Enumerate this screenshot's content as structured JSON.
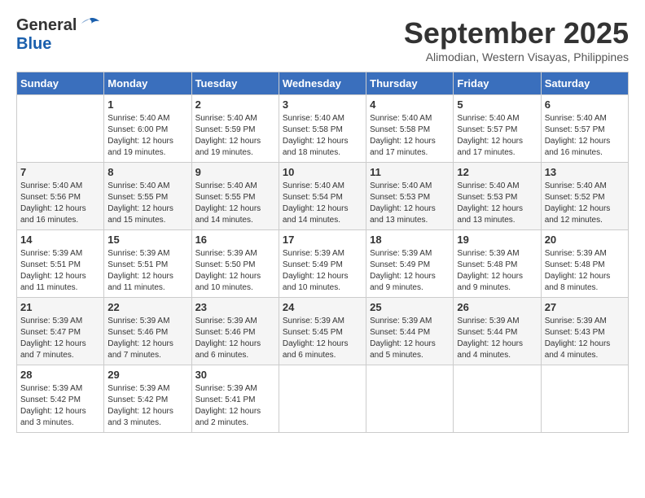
{
  "header": {
    "logo": {
      "general": "General",
      "blue": "Blue"
    },
    "title": "September 2025",
    "subtitle": "Alimodian, Western Visayas, Philippines"
  },
  "days_of_week": [
    "Sunday",
    "Monday",
    "Tuesday",
    "Wednesday",
    "Thursday",
    "Friday",
    "Saturday"
  ],
  "weeks": [
    [
      {
        "day": "",
        "sunrise": "",
        "sunset": "",
        "daylight": ""
      },
      {
        "day": "1",
        "sunrise": "Sunrise: 5:40 AM",
        "sunset": "Sunset: 6:00 PM",
        "daylight": "Daylight: 12 hours and 19 minutes."
      },
      {
        "day": "2",
        "sunrise": "Sunrise: 5:40 AM",
        "sunset": "Sunset: 5:59 PM",
        "daylight": "Daylight: 12 hours and 19 minutes."
      },
      {
        "day": "3",
        "sunrise": "Sunrise: 5:40 AM",
        "sunset": "Sunset: 5:58 PM",
        "daylight": "Daylight: 12 hours and 18 minutes."
      },
      {
        "day": "4",
        "sunrise": "Sunrise: 5:40 AM",
        "sunset": "Sunset: 5:58 PM",
        "daylight": "Daylight: 12 hours and 17 minutes."
      },
      {
        "day": "5",
        "sunrise": "Sunrise: 5:40 AM",
        "sunset": "Sunset: 5:57 PM",
        "daylight": "Daylight: 12 hours and 17 minutes."
      },
      {
        "day": "6",
        "sunrise": "Sunrise: 5:40 AM",
        "sunset": "Sunset: 5:57 PM",
        "daylight": "Daylight: 12 hours and 16 minutes."
      }
    ],
    [
      {
        "day": "7",
        "sunrise": "Sunrise: 5:40 AM",
        "sunset": "Sunset: 5:56 PM",
        "daylight": "Daylight: 12 hours and 16 minutes."
      },
      {
        "day": "8",
        "sunrise": "Sunrise: 5:40 AM",
        "sunset": "Sunset: 5:55 PM",
        "daylight": "Daylight: 12 hours and 15 minutes."
      },
      {
        "day": "9",
        "sunrise": "Sunrise: 5:40 AM",
        "sunset": "Sunset: 5:55 PM",
        "daylight": "Daylight: 12 hours and 14 minutes."
      },
      {
        "day": "10",
        "sunrise": "Sunrise: 5:40 AM",
        "sunset": "Sunset: 5:54 PM",
        "daylight": "Daylight: 12 hours and 14 minutes."
      },
      {
        "day": "11",
        "sunrise": "Sunrise: 5:40 AM",
        "sunset": "Sunset: 5:53 PM",
        "daylight": "Daylight: 12 hours and 13 minutes."
      },
      {
        "day": "12",
        "sunrise": "Sunrise: 5:40 AM",
        "sunset": "Sunset: 5:53 PM",
        "daylight": "Daylight: 12 hours and 13 minutes."
      },
      {
        "day": "13",
        "sunrise": "Sunrise: 5:40 AM",
        "sunset": "Sunset: 5:52 PM",
        "daylight": "Daylight: 12 hours and 12 minutes."
      }
    ],
    [
      {
        "day": "14",
        "sunrise": "Sunrise: 5:39 AM",
        "sunset": "Sunset: 5:51 PM",
        "daylight": "Daylight: 12 hours and 11 minutes."
      },
      {
        "day": "15",
        "sunrise": "Sunrise: 5:39 AM",
        "sunset": "Sunset: 5:51 PM",
        "daylight": "Daylight: 12 hours and 11 minutes."
      },
      {
        "day": "16",
        "sunrise": "Sunrise: 5:39 AM",
        "sunset": "Sunset: 5:50 PM",
        "daylight": "Daylight: 12 hours and 10 minutes."
      },
      {
        "day": "17",
        "sunrise": "Sunrise: 5:39 AM",
        "sunset": "Sunset: 5:49 PM",
        "daylight": "Daylight: 12 hours and 10 minutes."
      },
      {
        "day": "18",
        "sunrise": "Sunrise: 5:39 AM",
        "sunset": "Sunset: 5:49 PM",
        "daylight": "Daylight: 12 hours and 9 minutes."
      },
      {
        "day": "19",
        "sunrise": "Sunrise: 5:39 AM",
        "sunset": "Sunset: 5:48 PM",
        "daylight": "Daylight: 12 hours and 9 minutes."
      },
      {
        "day": "20",
        "sunrise": "Sunrise: 5:39 AM",
        "sunset": "Sunset: 5:48 PM",
        "daylight": "Daylight: 12 hours and 8 minutes."
      }
    ],
    [
      {
        "day": "21",
        "sunrise": "Sunrise: 5:39 AM",
        "sunset": "Sunset: 5:47 PM",
        "daylight": "Daylight: 12 hours and 7 minutes."
      },
      {
        "day": "22",
        "sunrise": "Sunrise: 5:39 AM",
        "sunset": "Sunset: 5:46 PM",
        "daylight": "Daylight: 12 hours and 7 minutes."
      },
      {
        "day": "23",
        "sunrise": "Sunrise: 5:39 AM",
        "sunset": "Sunset: 5:46 PM",
        "daylight": "Daylight: 12 hours and 6 minutes."
      },
      {
        "day": "24",
        "sunrise": "Sunrise: 5:39 AM",
        "sunset": "Sunset: 5:45 PM",
        "daylight": "Daylight: 12 hours and 6 minutes."
      },
      {
        "day": "25",
        "sunrise": "Sunrise: 5:39 AM",
        "sunset": "Sunset: 5:44 PM",
        "daylight": "Daylight: 12 hours and 5 minutes."
      },
      {
        "day": "26",
        "sunrise": "Sunrise: 5:39 AM",
        "sunset": "Sunset: 5:44 PM",
        "daylight": "Daylight: 12 hours and 4 minutes."
      },
      {
        "day": "27",
        "sunrise": "Sunrise: 5:39 AM",
        "sunset": "Sunset: 5:43 PM",
        "daylight": "Daylight: 12 hours and 4 minutes."
      }
    ],
    [
      {
        "day": "28",
        "sunrise": "Sunrise: 5:39 AM",
        "sunset": "Sunset: 5:42 PM",
        "daylight": "Daylight: 12 hours and 3 minutes."
      },
      {
        "day": "29",
        "sunrise": "Sunrise: 5:39 AM",
        "sunset": "Sunset: 5:42 PM",
        "daylight": "Daylight: 12 hours and 3 minutes."
      },
      {
        "day": "30",
        "sunrise": "Sunrise: 5:39 AM",
        "sunset": "Sunset: 5:41 PM",
        "daylight": "Daylight: 12 hours and 2 minutes."
      },
      {
        "day": "",
        "sunrise": "",
        "sunset": "",
        "daylight": ""
      },
      {
        "day": "",
        "sunrise": "",
        "sunset": "",
        "daylight": ""
      },
      {
        "day": "",
        "sunrise": "",
        "sunset": "",
        "daylight": ""
      },
      {
        "day": "",
        "sunrise": "",
        "sunset": "",
        "daylight": ""
      }
    ]
  ]
}
